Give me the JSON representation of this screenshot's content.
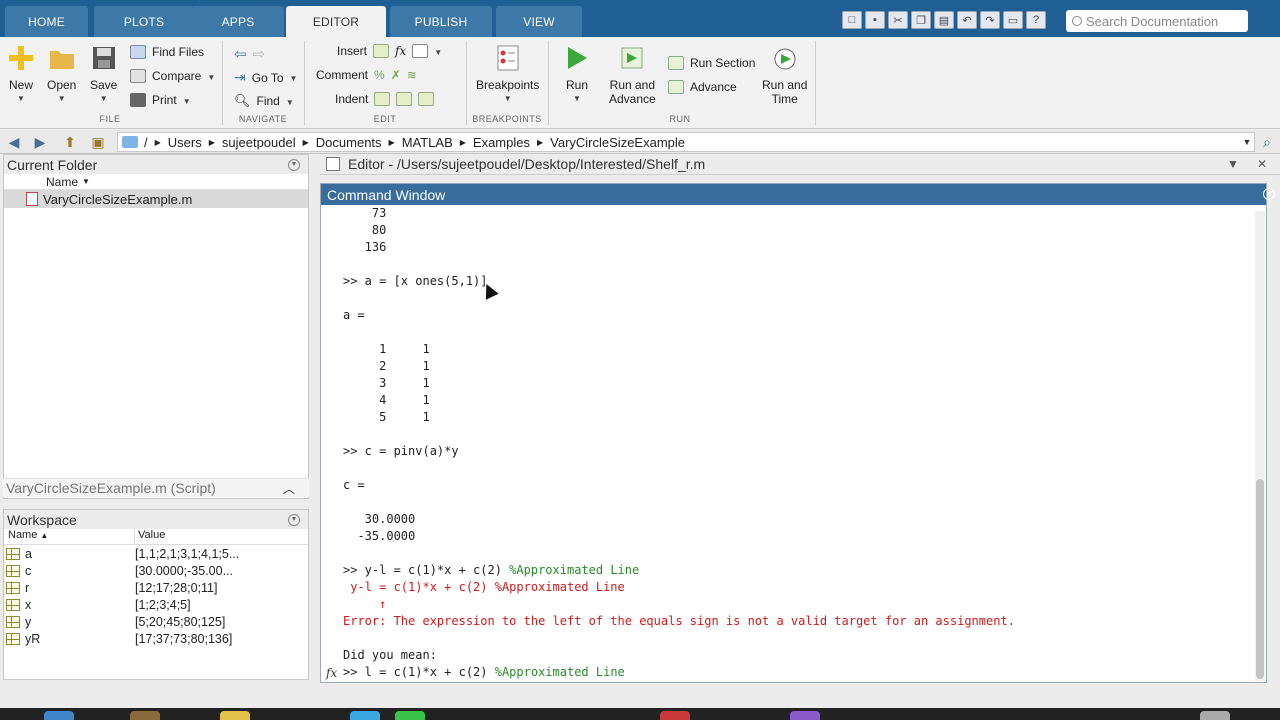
{
  "tabs": [
    {
      "label": "HOME",
      "state": "dim"
    },
    {
      "label": "PLOTS",
      "state": "dim"
    },
    {
      "label": "APPS",
      "state": "dim"
    },
    {
      "label": "EDITOR",
      "state": "active"
    },
    {
      "label": "PUBLISH",
      "state": "dim"
    },
    {
      "label": "VIEW",
      "state": "dim"
    }
  ],
  "search": {
    "placeholder": "Search Documentation"
  },
  "ribbon": {
    "file": {
      "new": "New",
      "open": "Open",
      "save": "Save",
      "find_files": "Find Files",
      "compare": "Compare",
      "print": "Print",
      "group": "FILE"
    },
    "navigate": {
      "go_to": "Go To",
      "find": "Find",
      "group": "NAVIGATE"
    },
    "edit": {
      "insert": "Insert",
      "comment": "Comment",
      "indent": "Indent",
      "group": "EDIT"
    },
    "breakpoints": {
      "label": "Breakpoints",
      "group": "BREAKPOINTS"
    },
    "run": {
      "run": "Run",
      "run_and_advance_1": "Run and",
      "run_and_advance_2": "Advance",
      "run_section": "Run Section",
      "advance": "Advance",
      "run_and_time_1": "Run and",
      "run_and_time_2": "Time",
      "group": "RUN"
    }
  },
  "path": {
    "root": "/",
    "segments": [
      "Users",
      "sujeetpoudel",
      "Documents",
      "MATLAB",
      "Examples",
      "VaryCircleSizeExample"
    ]
  },
  "current_folder": {
    "title": "Current Folder",
    "column": "Name",
    "files": [
      "VaryCircleSizeExample.m"
    ],
    "details": "VaryCircleSizeExample.m  (Script)"
  },
  "workspace": {
    "title": "Workspace",
    "col_name": "Name",
    "col_value": "Value",
    "vars": [
      {
        "name": "a",
        "value": "[1,1;2,1;3,1;4,1;5..."
      },
      {
        "name": "c",
        "value": "[30.0000;-35.00..."
      },
      {
        "name": "r",
        "value": "[12;17;28;0;11]"
      },
      {
        "name": "x",
        "value": "[1;2;3;4;5]"
      },
      {
        "name": "y",
        "value": "[5;20;45;80;125]"
      },
      {
        "name": "yR",
        "value": "[17;37;73;80;136]"
      }
    ]
  },
  "editor": {
    "title": "Editor - /Users/sujeetpoudel/Desktop/Interested/Shelf_r.m"
  },
  "command_window": {
    "title": "Command Window",
    "lines": [
      {
        "text": "    73",
        "class": ""
      },
      {
        "text": "    80",
        "class": ""
      },
      {
        "text": "   136",
        "class": ""
      },
      {
        "text": "",
        "class": ""
      },
      {
        "text": ">> a = [x ones(5,1)]",
        "class": ""
      },
      {
        "text": "",
        "class": ""
      },
      {
        "text": "a =",
        "class": ""
      },
      {
        "text": "",
        "class": ""
      },
      {
        "text": "     1     1",
        "class": ""
      },
      {
        "text": "     2     1",
        "class": ""
      },
      {
        "text": "     3     1",
        "class": ""
      },
      {
        "text": "     4     1",
        "class": ""
      },
      {
        "text": "     5     1",
        "class": ""
      },
      {
        "text": "",
        "class": ""
      },
      {
        "text": ">> c = pinv(a)*y",
        "class": ""
      },
      {
        "text": "",
        "class": ""
      },
      {
        "text": "c =",
        "class": ""
      },
      {
        "text": "",
        "class": ""
      },
      {
        "text": "   30.0000",
        "class": ""
      },
      {
        "text": "  -35.0000",
        "class": ""
      },
      {
        "text": "",
        "class": ""
      },
      {
        "text": ">> y-l = c(1)*x + c(2) ",
        "comment": "%Approximated Line",
        "class": ""
      },
      {
        "text": " y-l = c(1)*x + c(2) %Approximated Line",
        "class": "red"
      },
      {
        "text": "     ↑",
        "class": "red"
      },
      {
        "text": "Error: The expression to the left of the equals sign is not a valid target for an assignment.",
        "class": "red"
      },
      {
        "text": "",
        "class": ""
      },
      {
        "text": "Did you mean:",
        "class": ""
      },
      {
        "text": ">> l = c(1)*x + c(2) ",
        "comment": "%Approximated Line",
        "class": ""
      }
    ]
  }
}
